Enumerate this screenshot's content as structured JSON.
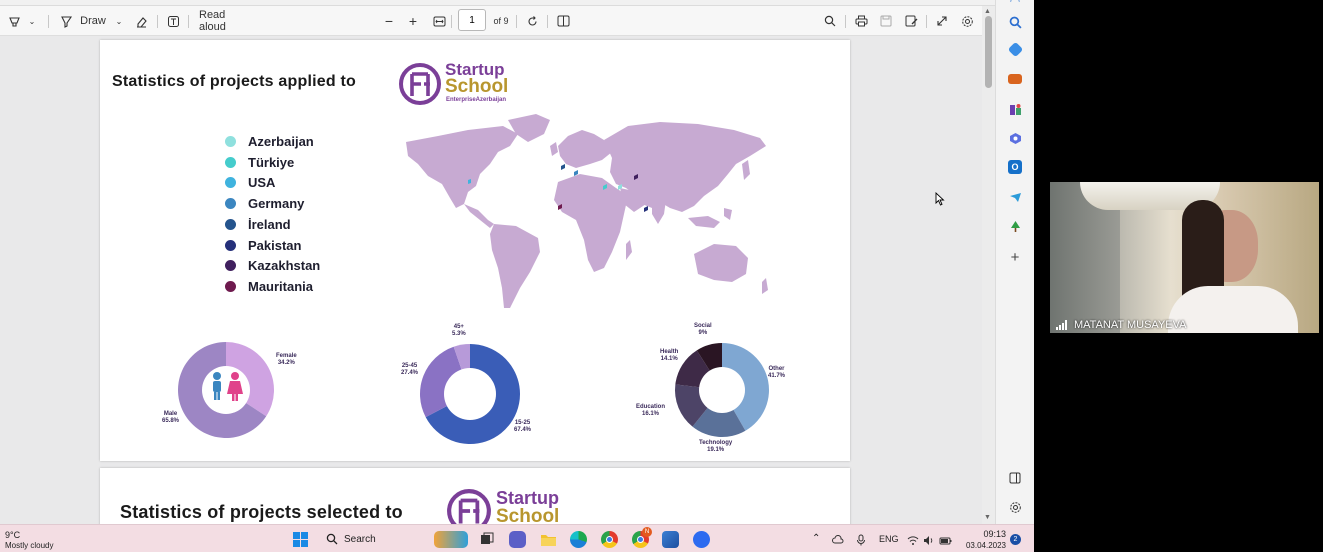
{
  "toolbar": {
    "draw_label": "Draw",
    "read_aloud_label": "Read aloud",
    "page_current": "1",
    "page_total": "of 9"
  },
  "page1": {
    "title": "Statistics of projects applied to",
    "logo": {
      "line1": "Startup",
      "line2": "School",
      "tagline": "EnterpriseAzerbaijan"
    },
    "legend": [
      {
        "label": "Azerbaijan",
        "color": "#8fe0de"
      },
      {
        "label": "Türkiye",
        "color": "#45cccc"
      },
      {
        "label": "USA",
        "color": "#3fb3de"
      },
      {
        "label": "Germany",
        "color": "#3b86c0"
      },
      {
        "label": "İreland",
        "color": "#24548d"
      },
      {
        "label": "Pakistan",
        "color": "#25307a"
      },
      {
        "label": "Kazakhstan",
        "color": "#40205e"
      },
      {
        "label": "Mauritania",
        "color": "#6e1a4e"
      }
    ],
    "gender_chart": {
      "female_label": "Female",
      "female_value": "34.2%",
      "male_label": "Male",
      "male_value": "65.8%"
    },
    "age_chart": {
      "a_label": "45+",
      "a_value": "5.3%",
      "b_label": "25-45",
      "b_value": "27.4%",
      "c_label": "15-25",
      "c_value": "67.4%"
    },
    "sector_chart": {
      "social_label": "Social",
      "social_value": "9%",
      "health_label": "Health",
      "health_value": "14.1%",
      "education_label": "Education",
      "education_value": "16.1%",
      "technology_label": "Technology",
      "technology_value": "19.1%",
      "other_label": "Other",
      "other_value": "41.7%"
    }
  },
  "page2": {
    "title": "Statistics of projects selected to",
    "logo": {
      "line1": "Startup",
      "line2": "School"
    }
  },
  "video": {
    "participant_name": "MATANAT MUSAYEVA"
  },
  "taskbar": {
    "weather_temp": "9°C",
    "weather_desc": "Mostly cloudy",
    "search_label": "Search",
    "language": "ENG",
    "time": "09:13",
    "date": "03.04.2023",
    "notification_count": "2",
    "chrome_badge": "N"
  },
  "colors": {
    "purple": "#7b3f98",
    "gold": "#b8962e",
    "map": "#c7aad2",
    "taskbar": "#f3dde3"
  }
}
